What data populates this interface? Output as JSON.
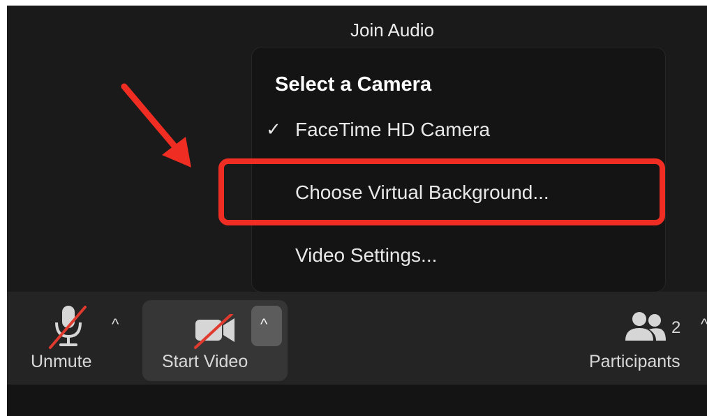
{
  "header": {
    "join_audio": "Join Audio"
  },
  "camera_menu": {
    "heading": "Select a Camera",
    "items": [
      {
        "label": "FaceTime HD Camera",
        "checked": true
      },
      {
        "label": "Choose Virtual Background..."
      },
      {
        "label": "Video Settings..."
      }
    ],
    "check_glyph": "✓"
  },
  "toolbar": {
    "unmute_label": "Unmute",
    "start_video_label": "Start Video",
    "participants_label": "Participants",
    "participant_count": "2",
    "caret_glyph": "^"
  },
  "annotations": {
    "highlight_color": "#f02d22",
    "arrow_color": "#f02d22"
  },
  "icons": [
    "microphone-muted-icon",
    "video-camera-off-icon",
    "chevron-up-icon",
    "participants-icon"
  ]
}
